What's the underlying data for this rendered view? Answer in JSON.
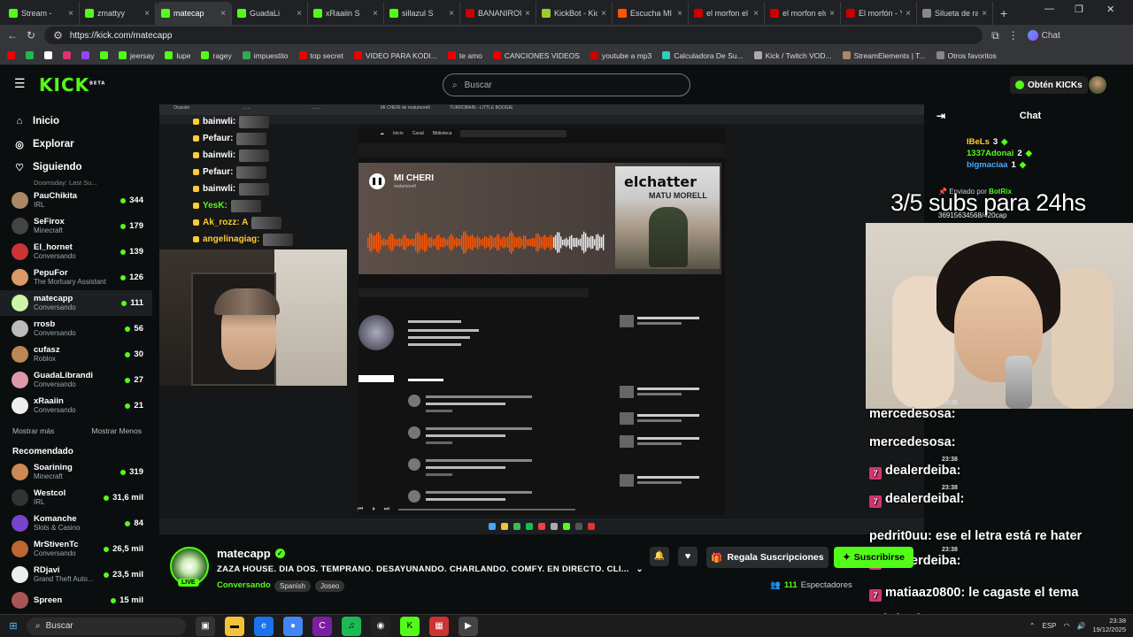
{
  "tabs": [
    {
      "label": "Stream - ",
      "color": "#53fc18"
    },
    {
      "label": "zmattyy",
      "color": "#53fc18"
    },
    {
      "label": "matecap",
      "color": "#53fc18",
      "active": true
    },
    {
      "label": "GuadaLi",
      "color": "#53fc18"
    },
    {
      "label": "xRaaiin S",
      "color": "#53fc18"
    },
    {
      "label": "sillazul S",
      "color": "#53fc18"
    },
    {
      "label": "BANANIROU",
      "color": "#c00"
    },
    {
      "label": "KickBot - Kick",
      "color": "#9acd32"
    },
    {
      "label": "Escucha MI C",
      "color": "#ff5500"
    },
    {
      "label": "el morfon el",
      "color": "#c00"
    },
    {
      "label": "el morfon elu",
      "color": "#c00"
    },
    {
      "label": "El morfón - Y",
      "color": "#c00"
    },
    {
      "label": "Silueta de rat",
      "color": "#888"
    }
  ],
  "browser": {
    "url": "https://kick.com/matecapp",
    "chat_label": "Chat"
  },
  "bookmarks": [
    {
      "label": "",
      "color": "#e00"
    },
    {
      "label": "",
      "color": "#1db954"
    },
    {
      "label": "",
      "color": "#fff"
    },
    {
      "label": "",
      "color": "#e1306c"
    },
    {
      "label": "",
      "color": "#9146ff"
    },
    {
      "label": "",
      "color": "#53fc18"
    },
    {
      "label": "jeersay",
      "color": "#53fc18"
    },
    {
      "label": "lupe",
      "color": "#53fc18"
    },
    {
      "label": "ragey",
      "color": "#53fc18"
    },
    {
      "label": "impuestito",
      "color": "#34a853"
    },
    {
      "label": "top secret",
      "color": "#e00"
    },
    {
      "label": "VIDEO PARA KODI...",
      "color": "#e00"
    },
    {
      "label": "te amo",
      "color": "#e00"
    },
    {
      "label": "CANCIONES VIDEOS",
      "color": "#e00"
    },
    {
      "label": "youtube a mp3",
      "color": "#c00"
    },
    {
      "label": "Calculadora De Su...",
      "color": "#3cb"
    },
    {
      "label": "Kick / Twitch VOD...",
      "color": "#aaa"
    },
    {
      "label": "StreamElements | T...",
      "color": "#a86"
    },
    {
      "label": "Otros favoritos",
      "color": "#888"
    }
  ],
  "kick": {
    "logo": "KICK",
    "logo_beta": "BETA",
    "search_placeholder": "Buscar",
    "get_kicks": "Obtén KICKs"
  },
  "nav": [
    {
      "label": "Inicio",
      "icon": "home-icon"
    },
    {
      "label": "Explorar",
      "icon": "compass-icon"
    },
    {
      "label": "Siguiendo",
      "icon": "heart-icon"
    }
  ],
  "following_cutoff": "Doomsday: Last Su...",
  "following": [
    {
      "name": "PauChikita",
      "category": "IRL",
      "viewers": "344",
      "color": "#a86"
    },
    {
      "name": "SeFirox",
      "category": "Minecraft",
      "viewers": "179",
      "color": "#444"
    },
    {
      "name": "El_hornet",
      "category": "Conversando",
      "viewers": "139",
      "color": "#c33"
    },
    {
      "name": "PepuFor",
      "category": "The Mortuary Assistant",
      "viewers": "126",
      "color": "#d96"
    },
    {
      "name": "matecapp",
      "category": "Conversando",
      "viewers": "111",
      "color": "#cdf5a7",
      "selected": true
    },
    {
      "name": "rrosb",
      "category": "Conversando",
      "viewers": "56",
      "color": "#bbb"
    },
    {
      "name": "cufasz",
      "category": "Roblox",
      "viewers": "30",
      "color": "#b85"
    },
    {
      "name": "GuadaLibrandi",
      "category": "Conversando",
      "viewers": "27",
      "color": "#d9a"
    },
    {
      "name": "xRaaiin",
      "category": "Conversando",
      "viewers": "21",
      "color": "#eee"
    }
  ],
  "show_more": "Mostrar más",
  "show_less": "Mostrar Menos",
  "recommended_title": "Recomendado",
  "recommended": [
    {
      "name": "Soarining",
      "category": "Minecraft",
      "viewers": "319",
      "color": "#c85"
    },
    {
      "name": "Westcol",
      "category": "IRL",
      "viewers": "31,6 mil",
      "color": "#333"
    },
    {
      "name": "Komanche",
      "category": "Slots & Casino",
      "viewers": "84",
      "color": "#74c"
    },
    {
      "name": "MrStivenTc",
      "category": "Conversando",
      "viewers": "26,5 mil",
      "color": "#b63"
    },
    {
      "name": "RDjavi",
      "category": "Grand Theft Auto...",
      "viewers": "23,5 mil",
      "color": "#eee"
    },
    {
      "name": "Spreen",
      "category": "",
      "viewers": "15 mil",
      "color": "#a55"
    }
  ],
  "player": {
    "song_title": "MI CHERI",
    "song_artist": "matumorell",
    "cover_line1": "elchatter",
    "cover_line2": "MATU MORELL",
    "overlay_chat": [
      {
        "user": "bainwli:"
      },
      {
        "user": "Pefaur:"
      },
      {
        "user": "bainwli:"
      },
      {
        "user": "Pefaur:"
      },
      {
        "user": "bainwli:"
      },
      {
        "user": "YesK:"
      },
      {
        "user": "Ak_rozz: A"
      },
      {
        "user": "angelinagiag:"
      }
    ]
  },
  "subs_goal": "3/5 subs para 24hs",
  "chat": {
    "title": "Chat",
    "gifters": [
      {
        "name": "IBeLs",
        "count": "3",
        "rank": "1"
      },
      {
        "name": "1337Adonai",
        "count": "2",
        "rank": ""
      },
      {
        "name": "bigmaciaa",
        "count": "1",
        "rank": ""
      }
    ],
    "pinned_by": "Enviado por",
    "pinned_user": "BotRix",
    "pinned_text": "36915634568/420cap",
    "lines": [
      {
        "time": "23:38",
        "user": "",
        "text": "mercedesosa:",
        "badge": false
      },
      {
        "time": "",
        "user": "",
        "text": "mercedesosa:",
        "badge": false
      },
      {
        "time": "23:38",
        "user": "",
        "text": "dealerdeiba:",
        "badge": true
      },
      {
        "time": "23:38",
        "user": "",
        "text": "dealerdeibal:",
        "badge": true
      },
      {
        "time": "",
        "user": "",
        "text": "pedrit0uu: ese el letra está re hater",
        "badge": false
      },
      {
        "time": "23:38",
        "user": "",
        "text": "dealerdeiba:",
        "badge": true
      },
      {
        "time": "",
        "user": "",
        "text": "matiaaz0800: le cagaste el tema",
        "badge": true
      }
    ],
    "original_word": "original"
  },
  "stream": {
    "name": "matecapp",
    "live": "LIVE",
    "title": "ZAZA HOUSE. DIA DOS. TEMPRANO. DESAYUNANDO. CHARLANDO. COMFY. EN DIRECTO. CLI...",
    "category": "Conversando",
    "tags": [
      "Spanish",
      "Joseo"
    ],
    "gift_label": "Regala Suscripciones",
    "subscribe_label": "Suscribirse",
    "viewers": "111",
    "viewers_label": "Espectadores"
  },
  "taskbar": {
    "search": "Buscar",
    "lang": "ESP",
    "time": "23:38",
    "date": "19/12/2025"
  }
}
